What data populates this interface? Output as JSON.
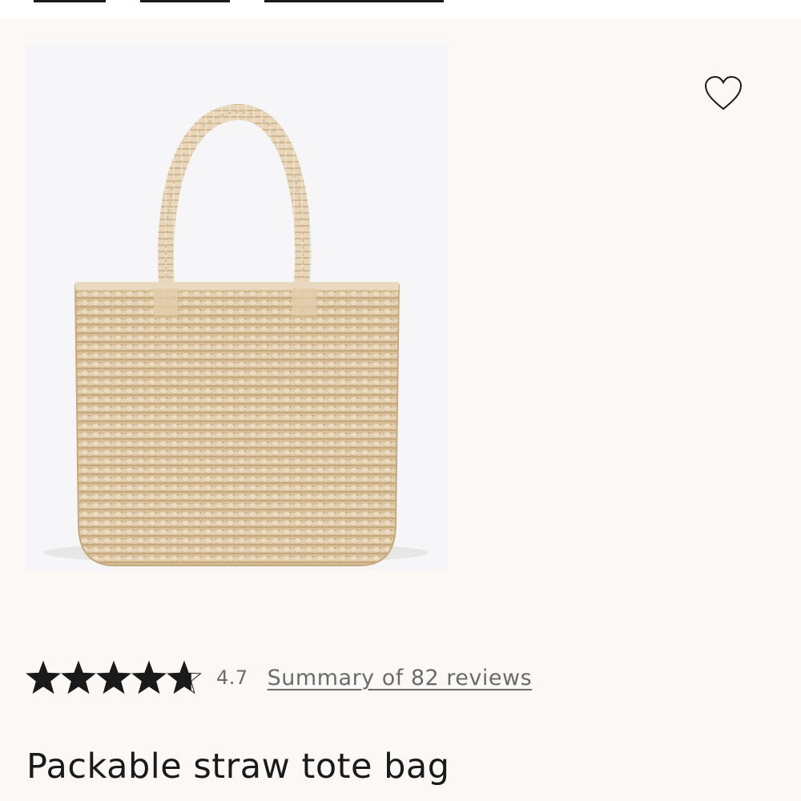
{
  "header": {
    "nav_tabs": [
      "",
      "",
      ""
    ]
  },
  "product": {
    "image_alt": "straw tote bag product photo",
    "favorite_icon": "heart-outline-icon",
    "rating": {
      "stars_filled": 4.7,
      "stars_total": 5,
      "value": "4.7",
      "reviews_link": "Summary of 82 reviews"
    },
    "title": "Packable straw tote bag"
  },
  "colors": {
    "page_background": "#fcf8f6",
    "image_background": "#f6f6f8",
    "text_primary": "#1a1a1a",
    "text_secondary": "#6b6b6b",
    "straw": "#dcc3a0"
  }
}
